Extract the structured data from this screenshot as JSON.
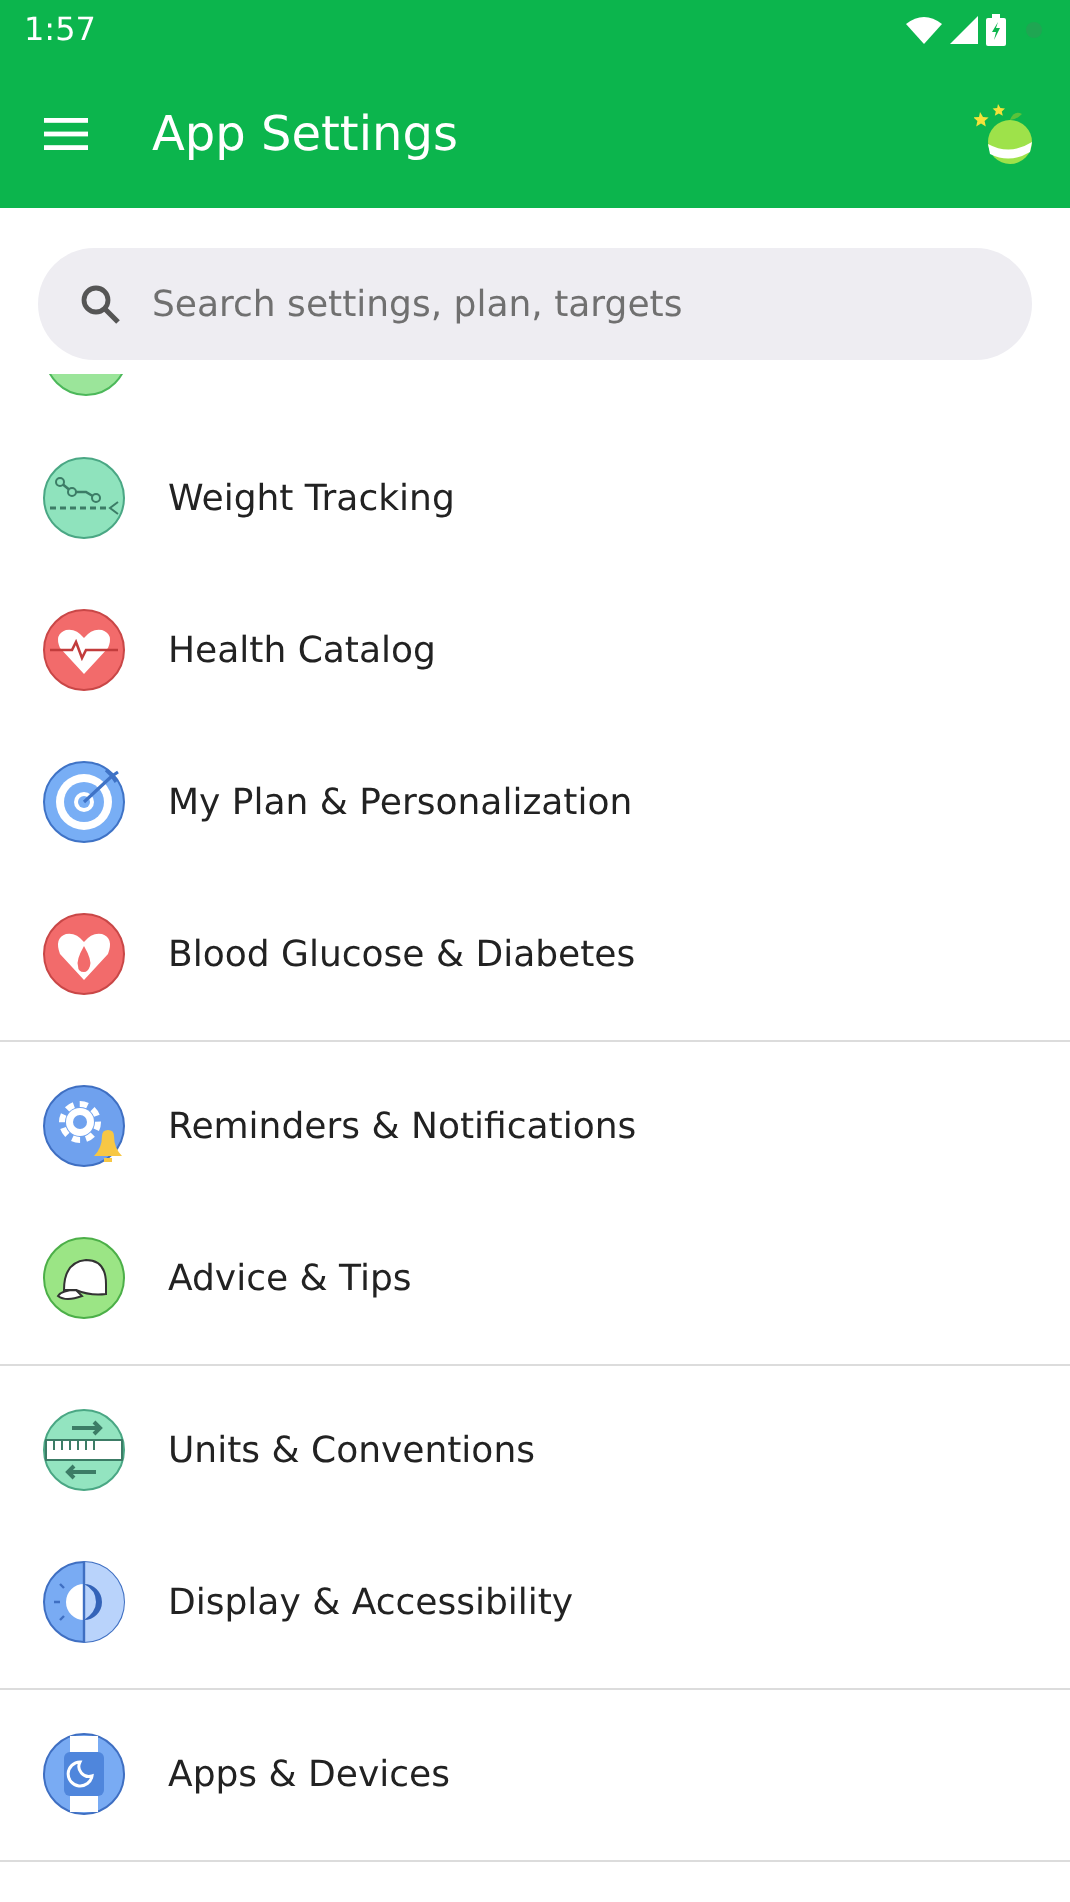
{
  "status_bar": {
    "time": "1:57"
  },
  "app_bar": {
    "title": "App Settings"
  },
  "search": {
    "placeholder": "Search settings, plan, targets"
  },
  "sections": [
    {
      "items": [
        {
          "label": "Weight Tracking",
          "kind": "chart"
        },
        {
          "label": "Health Catalog",
          "kind": "heart"
        },
        {
          "label": "My Plan & Personalization",
          "kind": "target"
        },
        {
          "label": "Blood Glucose & Diabetes",
          "kind": "drop"
        }
      ]
    },
    {
      "items": [
        {
          "label": "Reminders & Notifications",
          "kind": "gear"
        },
        {
          "label": "Advice & Tips",
          "kind": "cap"
        }
      ]
    },
    {
      "items": [
        {
          "label": "Units & Conventions",
          "kind": "ruler"
        },
        {
          "label": "Display & Accessibility",
          "kind": "contrast"
        }
      ]
    },
    {
      "items": [
        {
          "label": "Apps & Devices",
          "kind": "watch"
        }
      ]
    }
  ]
}
